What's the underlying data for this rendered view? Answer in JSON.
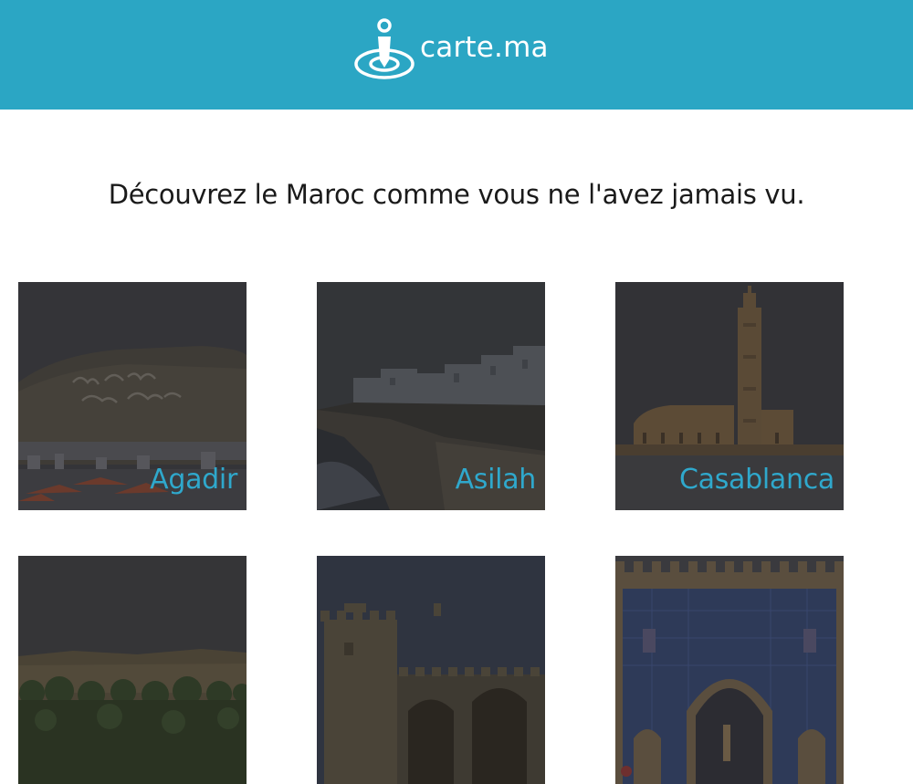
{
  "header": {
    "brand": "carte.ma",
    "bg_color": "#2ba6c4",
    "logo_icon": "location-pin-icon"
  },
  "tagline": "Découvrez le Maroc comme vous ne l'avez jamais vu.",
  "cities": [
    {
      "name": "Agadir"
    },
    {
      "name": "Asilah"
    },
    {
      "name": "Casablanca"
    },
    {
      "name": ""
    },
    {
      "name": ""
    },
    {
      "name": ""
    }
  ],
  "colors": {
    "accent": "#2fa8cc",
    "text": "#1a1a1a"
  }
}
